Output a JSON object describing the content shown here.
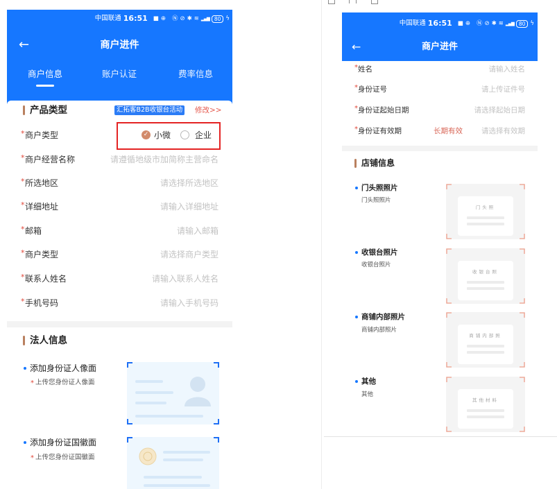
{
  "colors": {
    "brand_blue": "#1677ff",
    "section_bar": "#b9805f",
    "radio_checked": "#d28b6c",
    "required_mark": "#e0483a",
    "edit_link": "#e5584c",
    "highlight_box": "#e42323",
    "long_term": "#d9695a",
    "placeholder": "#c3c3c3",
    "badge_blue": "#2b7cf6",
    "corner_salmon": "#ef9f8b"
  },
  "required_mark": "*",
  "left_phone": {
    "status_bar": {
      "carrier": "中国联通",
      "time": "16:51",
      "battery": "80",
      "icons": [
        "notification-icon",
        "app-icon",
        "nfc-icon",
        "mute-icon",
        "bluetooth-icon",
        "wifi-icon",
        "signal-icon",
        "battery-icon",
        "charging-icon"
      ]
    },
    "header": {
      "title": "商户进件",
      "back_icon": "back-arrow-icon"
    },
    "tabs": [
      {
        "label": "商户信息",
        "active": true
      },
      {
        "label": "账户认证",
        "active": false
      },
      {
        "label": "费率信息",
        "active": false
      }
    ],
    "product_section": {
      "title": "产品类型",
      "badge": "汇拓客B2B收银台活动",
      "edit_link": "修改>>",
      "merchant_type": {
        "label": "商户类型",
        "options": [
          {
            "label": "小微",
            "selected": true
          },
          {
            "label": "企业",
            "selected": false
          }
        ]
      },
      "fields": [
        {
          "label": "商户经营名称",
          "placeholder": "请遵循地级市加简称主营命名"
        },
        {
          "label": "所选地区",
          "placeholder": "请选择所选地区"
        },
        {
          "label": "详细地址",
          "placeholder": "请输入详细地址"
        },
        {
          "label": "邮箱",
          "placeholder": "请输入邮箱"
        },
        {
          "label": "商户类型",
          "placeholder": "请选择商户类型"
        },
        {
          "label": "联系人姓名",
          "placeholder": "请输入联系人姓名"
        },
        {
          "label": "手机号码",
          "placeholder": "请输入手机号码"
        }
      ]
    },
    "legal_section": {
      "title": "法人信息",
      "uploads": [
        {
          "title": "添加身份证人像面",
          "hint": "上传您身份证人像面"
        },
        {
          "title": "添加身份证国徽面",
          "hint": "上传您身份证国徽面"
        }
      ]
    }
  },
  "right_phone": {
    "status_bar": {
      "carrier": "中国联通",
      "time": "16:51",
      "battery": "80",
      "icons": [
        "notification-icon",
        "app-icon",
        "nfc-icon",
        "mute-icon",
        "bluetooth-icon",
        "wifi-icon",
        "signal-icon",
        "battery-icon",
        "charging-icon"
      ]
    },
    "header": {
      "title": "商户进件",
      "back_icon": "back-arrow-icon"
    },
    "fields": [
      {
        "label": "姓名",
        "placeholder": "请输入姓名"
      },
      {
        "label": "身份证号",
        "placeholder": "请上传证件号"
      },
      {
        "label": "身份证起始日期",
        "placeholder": "请选择起始日期"
      },
      {
        "label": "身份证有效期",
        "option": "长期有效",
        "placeholder": "请选择有效期"
      }
    ],
    "shop_section": {
      "title": "店铺信息",
      "photos": [
        {
          "title": "门头照照片",
          "subtitle": "门头照照片",
          "sample": "门头照"
        },
        {
          "title": "收银台照片",
          "subtitle": "收银台照片",
          "sample": "收银台照"
        },
        {
          "title": "商铺内部照片",
          "subtitle": "商铺内部照片",
          "sample": "商铺内部照"
        },
        {
          "title": "其他",
          "subtitle": "其他",
          "sample": "其他材料"
        }
      ]
    }
  }
}
